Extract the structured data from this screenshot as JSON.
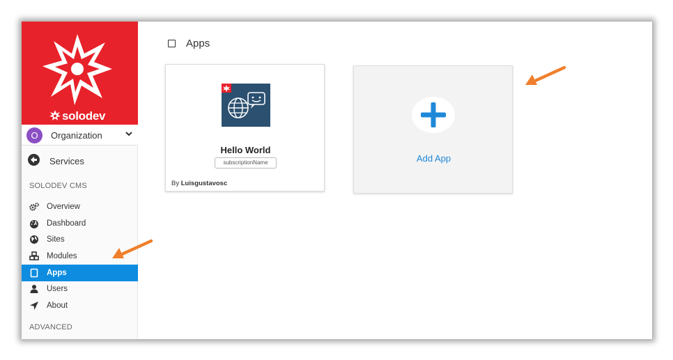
{
  "brand": {
    "name": "solodev",
    "accent": "#e8222a"
  },
  "org": {
    "avatar_letter": "O",
    "label": "Organization",
    "avatar_color": "#8b4fc4"
  },
  "services": {
    "label": "Services"
  },
  "sections": {
    "cms": "SOLODEV CMS",
    "advanced": "ADVANCED"
  },
  "nav": {
    "items": [
      {
        "label": "Overview",
        "icon": "gears-icon"
      },
      {
        "label": "Dashboard",
        "icon": "dashboard-icon"
      },
      {
        "label": "Sites",
        "icon": "globe-icon"
      },
      {
        "label": "Modules",
        "icon": "cubes-icon"
      },
      {
        "label": "Apps",
        "icon": "tablet-icon",
        "active": true
      },
      {
        "label": "Users",
        "icon": "user-icon"
      },
      {
        "label": "About",
        "icon": "location-arrow-icon"
      }
    ],
    "active_color": "#0d8ce0"
  },
  "page": {
    "title": "Apps"
  },
  "apps": [
    {
      "name": "Hello World",
      "subscription": "subscriptionName",
      "author_prefix": "By",
      "author": "Luisgustavosc"
    }
  ],
  "add_app": {
    "label": "Add App",
    "color": "#1e88d8"
  },
  "annotation_color": "#f07f2c"
}
